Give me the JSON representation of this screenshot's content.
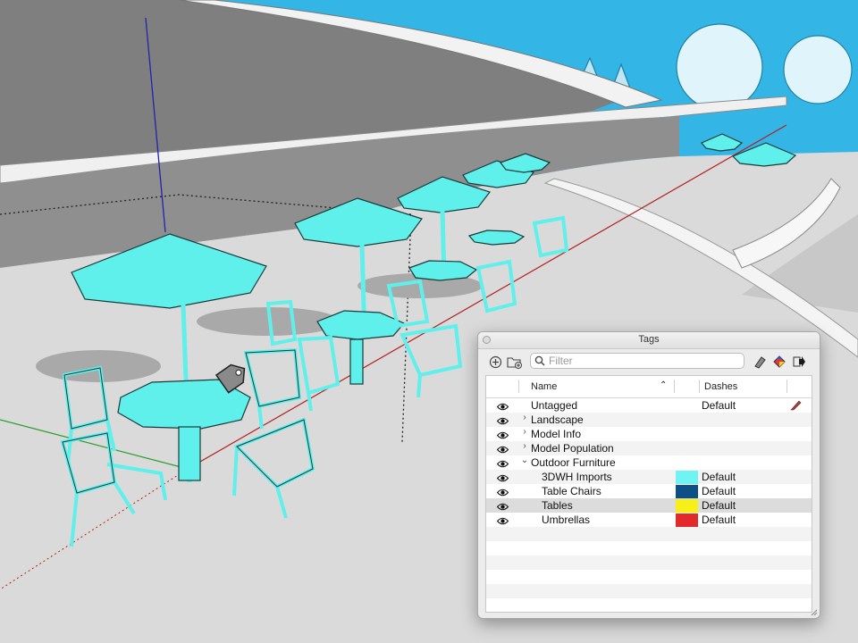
{
  "panel": {
    "title": "Tags",
    "search_placeholder": "Filter",
    "toolbar_icons": [
      "add-tag-icon",
      "add-folder-icon",
      "color-by-tag-icon",
      "details-icon",
      "export-icon"
    ],
    "columns": {
      "name": "Name",
      "dashes": "Dashes"
    },
    "rows": [
      {
        "name": "Untagged",
        "dashes": "Default",
        "level": 0,
        "disclosure": "",
        "color": "",
        "selected": false,
        "pencil": true
      },
      {
        "name": "Landscape",
        "dashes": "",
        "level": 0,
        "disclosure": "›",
        "color": "",
        "selected": false
      },
      {
        "name": "Model Info",
        "dashes": "",
        "level": 0,
        "disclosure": "›",
        "color": "",
        "selected": false
      },
      {
        "name": "Model Population",
        "dashes": "",
        "level": 0,
        "disclosure": "›",
        "color": "",
        "selected": false
      },
      {
        "name": "Outdoor Furniture",
        "dashes": "",
        "level": 0,
        "disclosure": "⌄",
        "color": "",
        "selected": false
      },
      {
        "name": "3DWH Imports",
        "dashes": "Default",
        "level": 1,
        "disclosure": "",
        "color": "#6ff3f3",
        "selected": false
      },
      {
        "name": "Table Chairs",
        "dashes": "Default",
        "level": 1,
        "disclosure": "",
        "color": "#0e4f86",
        "selected": false
      },
      {
        "name": "Tables",
        "dashes": "Default",
        "level": 1,
        "disclosure": "",
        "color": "#f7f018",
        "selected": true
      },
      {
        "name": "Umbrellas",
        "dashes": "Default",
        "level": 1,
        "disclosure": "",
        "color": "#e32a2a",
        "selected": false
      }
    ],
    "empty_rows": 6
  },
  "scene": {
    "colors": {
      "furniture": "#5ff0ec",
      "sky": "#31b7e8",
      "ground": "#d9d9d9",
      "wall": "#8a8a8a"
    }
  }
}
